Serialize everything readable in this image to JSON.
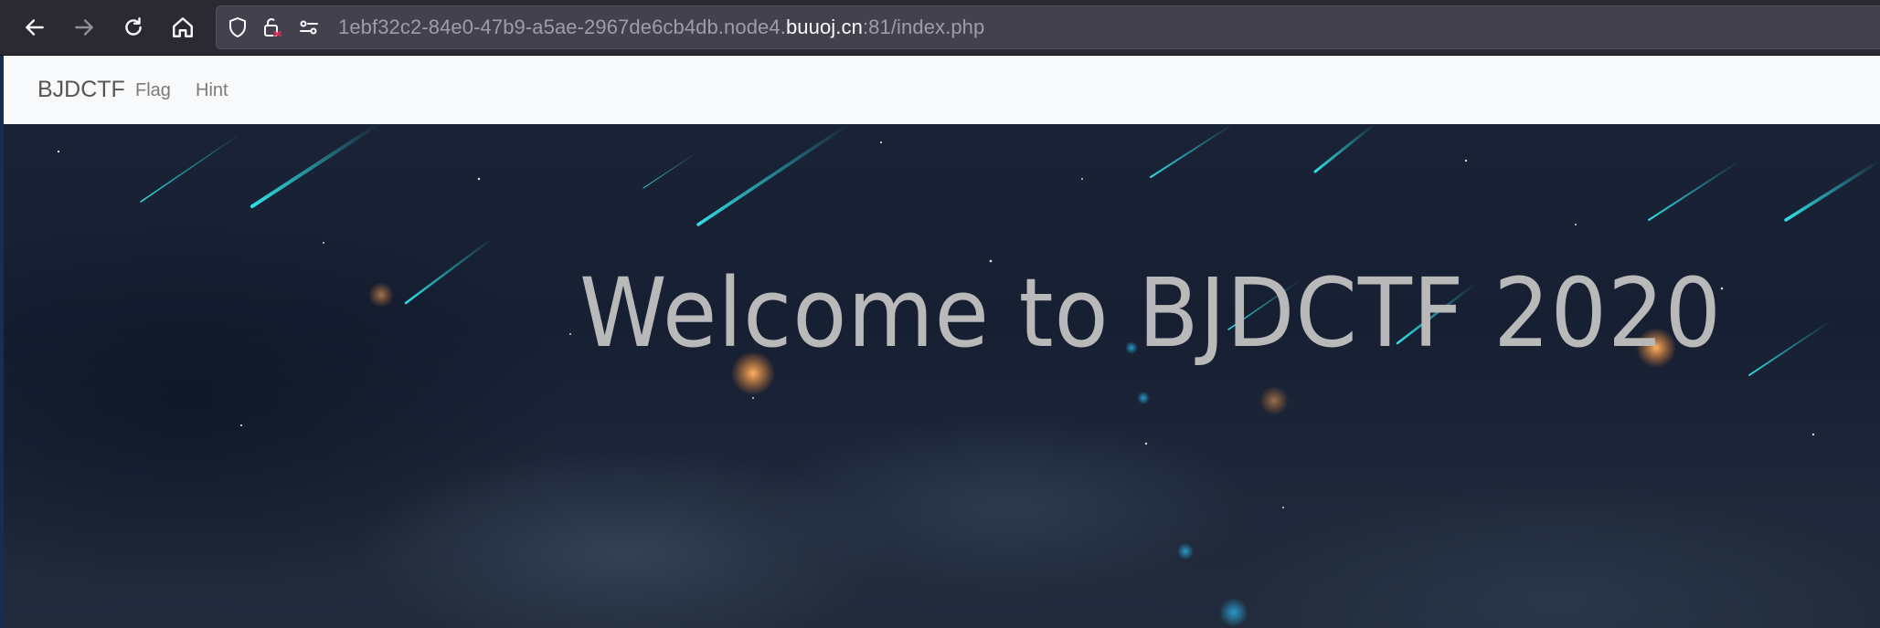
{
  "browser": {
    "url": {
      "prefix": "1ebf32c2-84e0-47b9-a5ae-2967de6cb4db.node4.",
      "host": "buuoj.cn",
      "suffix": ":81/index.php"
    },
    "icons": {
      "back": "arrow-left-icon",
      "forward": "arrow-right-icon",
      "reload": "reload-icon",
      "home": "home-icon",
      "shield": "shield-icon",
      "lock": "lock-warning-icon",
      "permissions": "permissions-icon"
    }
  },
  "site": {
    "brand": "BJDCTF",
    "nav": [
      {
        "label": "Flag"
      },
      {
        "label": "Hint"
      }
    ],
    "heading": "Welcome to BJDCTF 2020"
  },
  "colors": {
    "toolbar_bg": "#2b2a33",
    "urlbar_bg": "#42414d",
    "navbar_bg": "#f8f9fa",
    "heading": "#b9b9b9",
    "meteor": "#2fe0e6",
    "lock_warning": "#e22850"
  }
}
